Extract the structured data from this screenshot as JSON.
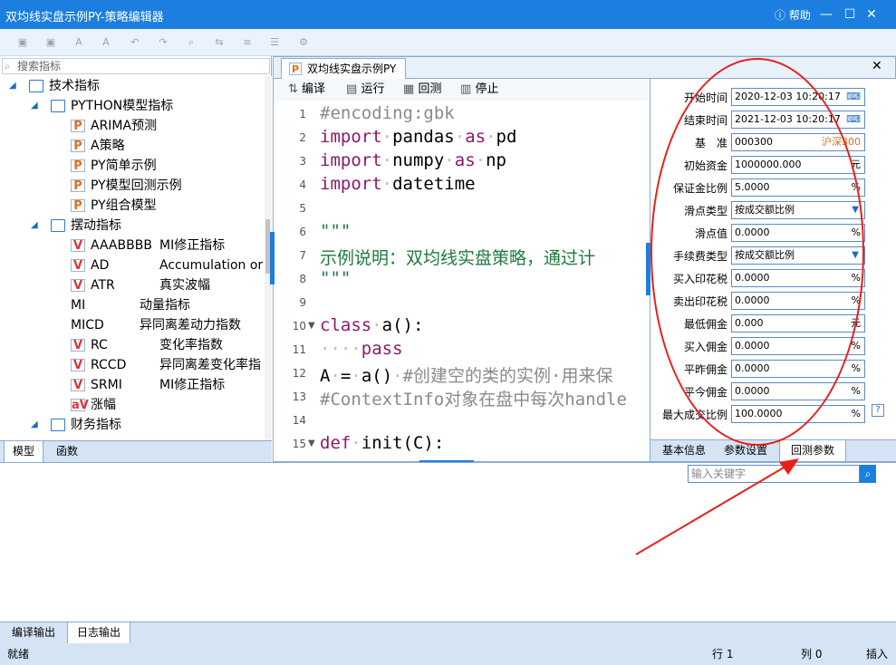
{
  "window": {
    "title": "双均线实盘示例PY-策略编辑器",
    "help_label": "帮助",
    "min": "—",
    "max": "☐",
    "close": "✕"
  },
  "toolbar": {
    "icons": [
      "save-icon",
      "save-all-icon",
      "font-decrease-icon",
      "font-increase-icon",
      "undo-icon",
      "redo-icon",
      "find-icon",
      "replace-icon",
      "goto-icon",
      "settings-icon"
    ]
  },
  "left": {
    "search_placeholder": "搜索指标",
    "tree": [
      {
        "level": 0,
        "type": "folder",
        "label": "技术指标",
        "expanded": true
      },
      {
        "level": 1,
        "type": "folder",
        "label": "PYTHON模型指标",
        "expanded": true
      },
      {
        "level": 2,
        "type": "p",
        "label": "ARIMA预测"
      },
      {
        "level": 2,
        "type": "p",
        "label": "A策略"
      },
      {
        "level": 2,
        "type": "p",
        "label": "PY简单示例"
      },
      {
        "level": 2,
        "type": "p",
        "label": "PY模型回测示例"
      },
      {
        "level": 2,
        "type": "p",
        "label": "PY组合模型"
      },
      {
        "level": 1,
        "type": "folder",
        "label": "摆动指标",
        "expanded": true
      },
      {
        "level": 2,
        "type": "v",
        "label": "AAABBBB",
        "desc": "MI修正指标"
      },
      {
        "level": 2,
        "type": "v",
        "label": "AD",
        "desc": "Accumulation or Di"
      },
      {
        "level": 2,
        "type": "v",
        "label": "ATR",
        "desc": "真实波幅"
      },
      {
        "level": 2,
        "type": "none",
        "label": "MI",
        "desc": "动量指标"
      },
      {
        "level": 2,
        "type": "none",
        "label": "MICD",
        "desc": "异同离差动力指数"
      },
      {
        "level": 2,
        "type": "v",
        "label": "RC",
        "desc": "变化率指数"
      },
      {
        "level": 2,
        "type": "v",
        "label": "RCCD",
        "desc": "异同离差变化率指"
      },
      {
        "level": 2,
        "type": "v",
        "label": "SRMI",
        "desc": "MI修正指标"
      },
      {
        "level": 2,
        "type": "av",
        "label": "涨幅"
      },
      {
        "level": 1,
        "type": "folder",
        "label": "财务指标",
        "expanded": true
      }
    ],
    "tabs": [
      "模型",
      "函数"
    ]
  },
  "editor": {
    "doc_tab": "双均线实盘示例PY",
    "tools": [
      "编译",
      "运行",
      "回测",
      "停止"
    ],
    "lines": [
      {
        "n": "1",
        "html": "<span class='cm'>#encoding:gbk</span>"
      },
      {
        "n": "2",
        "html": "<span class='kw'>import</span><span class='sp'>·</span>pandas<span class='sp'>·</span><span class='kw'>as</span><span class='sp'>·</span>pd"
      },
      {
        "n": "3",
        "html": "<span class='kw'>import</span><span class='sp'>·</span>numpy<span class='sp'>·</span><span class='kw'>as</span><span class='sp'>·</span>np"
      },
      {
        "n": "4",
        "html": "<span class='kw'>import</span><span class='sp'>·</span>datetime"
      },
      {
        "n": "5",
        "html": ""
      },
      {
        "n": "6",
        "html": "<span class='st'>\"\"\"</span>"
      },
      {
        "n": "7",
        "html": "<span class='st'>示例说明：双均线实盘策略，通过计</span>"
      },
      {
        "n": "8",
        "html": "<span class='st'>\"\"\"</span>"
      },
      {
        "n": "9",
        "html": ""
      },
      {
        "n": "10",
        "html": "<span class='kw'>class</span><span class='sp'>·</span>a():"
      },
      {
        "n": "11",
        "html": "<span class='sp'>····</span><span class='kw'>pass</span>"
      },
      {
        "n": "12",
        "html": "A<span class='sp'>·</span>=<span class='sp'>·</span>a()<span class='sp'>·</span><span class='cm'>#创建空的类的实例·用来保</span>"
      },
      {
        "n": "13",
        "html": "<span class='cm'>#ContextInfo对象在盘中每次handle</span>"
      },
      {
        "n": "14",
        "html": ""
      },
      {
        "n": "15",
        "html": "<span class='kw'>def</span><span class='sp'>·</span>init(C):"
      }
    ]
  },
  "params": {
    "fields": [
      {
        "label": "开始时间",
        "value": "2020-12-03 10:20:17",
        "suffix": "⌨"
      },
      {
        "label": "结束时间",
        "value": "2021-12-03 10:20:17",
        "suffix": "⌨"
      },
      {
        "label": "基　准",
        "value": "000300",
        "suffix": "沪深300"
      },
      {
        "label": "初始资金",
        "value": "1000000.000",
        "suffix": "元"
      },
      {
        "label": "保证金比例",
        "value": "5.0000",
        "suffix": "%"
      },
      {
        "label": "滑点类型",
        "value": "按成交额比例",
        "dropdown": "▼"
      },
      {
        "label": "滑点值",
        "value": "0.0000",
        "suffix": "%"
      },
      {
        "label": "手续费类型",
        "value": "按成交额比例",
        "dropdown": "▼"
      },
      {
        "label": "买入印花税",
        "value": "0.0000",
        "suffix": "%"
      },
      {
        "label": "卖出印花税",
        "value": "0.0000",
        "suffix": "%"
      },
      {
        "label": "最低佣金",
        "value": "0.000",
        "suffix": "元"
      },
      {
        "label": "买入佣金",
        "value": "0.0000",
        "suffix": "%"
      },
      {
        "label": "平昨佣金",
        "value": "0.0000",
        "suffix": "%"
      },
      {
        "label": "平今佣金",
        "value": "0.0000",
        "suffix": "%"
      },
      {
        "label": "最大成交比例",
        "value": "100.0000",
        "suffix": "%"
      }
    ],
    "tabs": [
      "基本信息",
      "参数设置",
      "回测参数"
    ]
  },
  "bottom": {
    "kw_placeholder": "输入关键字",
    "tabs": [
      "编译输出",
      "日志输出"
    ]
  },
  "status": {
    "left": "就绪",
    "row": "行 1",
    "col": "列 0",
    "mode": "插入"
  },
  "colors": {
    "accent": "#1c7fe0",
    "annotation": "#e8201b"
  }
}
